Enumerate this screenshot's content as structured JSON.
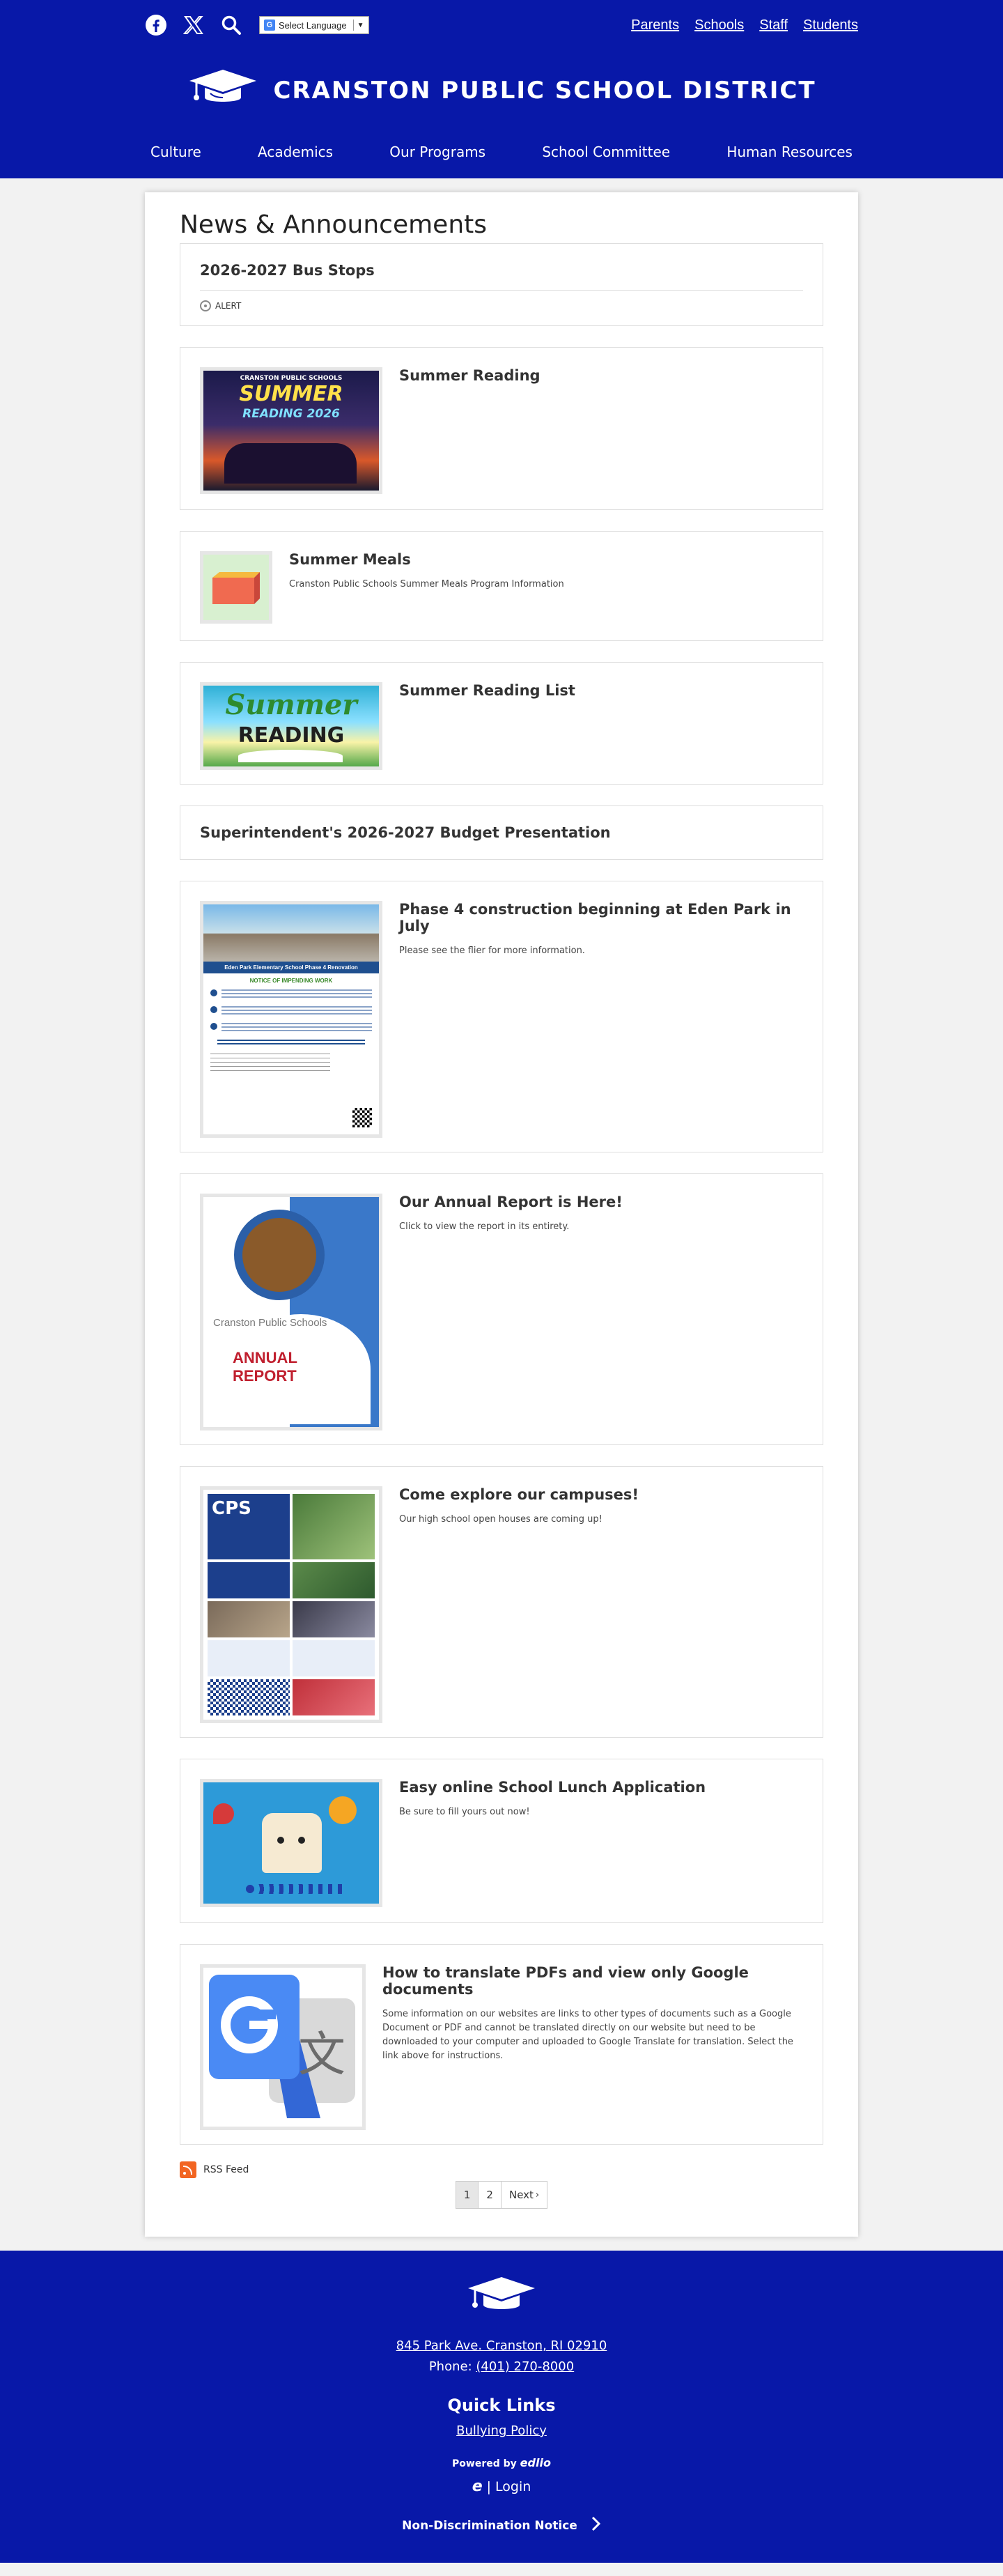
{
  "header": {
    "translate_label": "Select Language",
    "translate_arrow": "▼",
    "audience_links": [
      "Parents",
      "Schools",
      "Staff",
      "Students"
    ],
    "district_name": "CRANSTON PUBLIC SCHOOL DISTRICT",
    "nav": [
      "Culture",
      "Academics",
      "Our Programs",
      "School Committee",
      "Human Resources"
    ],
    "colors": {
      "brand_blue": "#0818a8",
      "white": "#ffffff"
    }
  },
  "main": {
    "title": "News & Announcements",
    "items": [
      {
        "title": "2026-2027 Bus Stops",
        "alert_label": "ALERT"
      },
      {
        "title": "Summer Reading",
        "description": "",
        "thumb": {
          "line1": "CRANSTON PUBLIC SCHOOLS",
          "line2": "SUMMER",
          "line3": "READING 2026"
        }
      },
      {
        "title": "Summer Meals",
        "description": "Cranston Public Schools Summer Meals Program Information"
      },
      {
        "title": "Summer Reading List",
        "description": "",
        "thumb": {
          "line1": "Summer",
          "line2": "READING"
        }
      },
      {
        "title": "Superintendent's 2026-2027 Budget Presentation"
      },
      {
        "title": "Phase 4 construction beginning at Eden Park in July",
        "description": "Please see the flier for more information.",
        "thumb": {
          "banner": "Eden Park Elementary School Phase 4 Renovation",
          "notice": "NOTICE OF IMPENDING WORK"
        }
      },
      {
        "title": "Our Annual Report is Here!",
        "description": "Click to view the report in its entirety.",
        "thumb": {
          "org": "Cranston Public Schools",
          "line1": "ANNUAL",
          "line2": "REPORT"
        }
      },
      {
        "title": "Come explore our campuses!",
        "description": "Our high school open houses are coming up!",
        "thumb": {
          "logo": "CPS"
        }
      },
      {
        "title": "Easy online School Lunch Application",
        "description": "Be sure to fill yours out now!"
      },
      {
        "title": "How to translate PDFs and view only Google documents",
        "description": "Some information on our websites are links to other types of documents such as a Google Document or PDF and cannot be translated directly on our website but need to be downloaded to your computer and uploaded to Google Translate for translation. Select the link above for instructions."
      }
    ],
    "rss_label": "RSS Feed",
    "pagination": {
      "pages": [
        "1",
        "2"
      ],
      "current": "1",
      "next_label": "Next"
    }
  },
  "footer": {
    "address": "845 Park Ave. Cranston, RI 02910",
    "phone_label": "Phone:",
    "phone": "(401) 270-8000",
    "quick_links_title": "Quick Links",
    "quick_links": [
      "Bullying Policy"
    ],
    "powered_by": "Powered by",
    "powered_brand": "edlio",
    "login_label": "Login",
    "ndn_label": "Non-Discrimination Notice"
  }
}
